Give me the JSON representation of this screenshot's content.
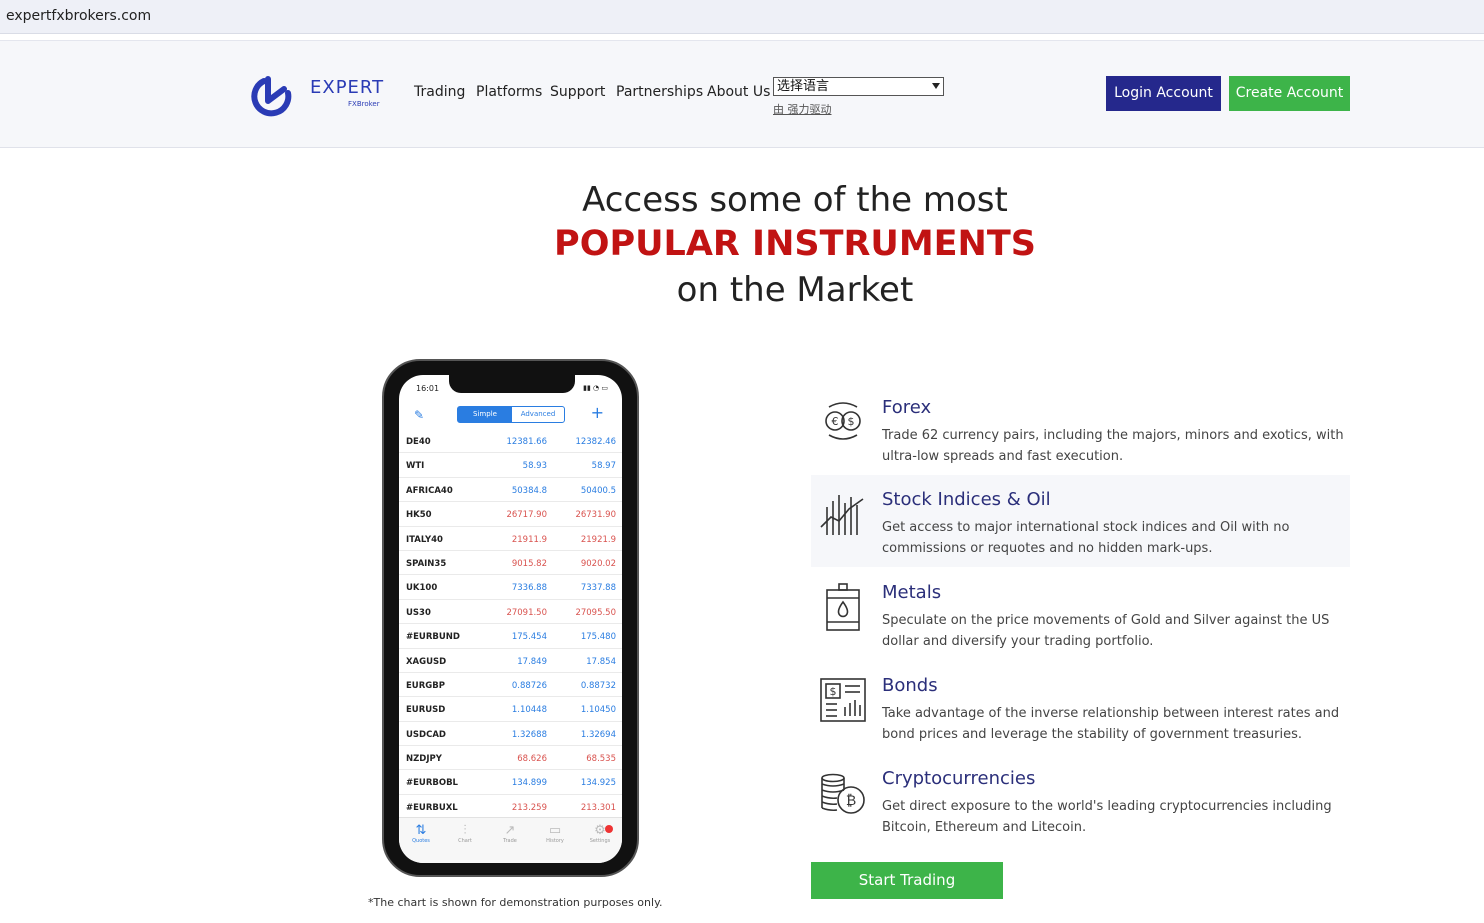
{
  "browser": {
    "url": "expertfxbrokers.com"
  },
  "header": {
    "logo_word": "EXPERT",
    "logo_sub": "FXBroker",
    "nav": [
      "Trading",
      "Platforms",
      "Support",
      "Partnerships",
      "About Us"
    ],
    "language_select": "选择语言",
    "powered_by": "由 强力驱动",
    "login_label": "Login Account",
    "create_label": "Create Account"
  },
  "hero": {
    "line1": "Access some of the most",
    "line2": "POPULAR INSTRUMENTS",
    "line3": "on the Market"
  },
  "phone": {
    "time": "16:01",
    "segment": {
      "simple": "Simple",
      "advanced": "Advanced"
    },
    "quotes": [
      {
        "symbol": "DE40",
        "bid": "12381.66",
        "ask": "12382.46",
        "color": "blue"
      },
      {
        "symbol": "WTI",
        "bid": "58.93",
        "ask": "58.97",
        "color": "blue"
      },
      {
        "symbol": "AFRICA40",
        "bid": "50384.8",
        "ask": "50400.5",
        "color": "blue"
      },
      {
        "symbol": "HK50",
        "bid": "26717.90",
        "ask": "26731.90",
        "color": "red"
      },
      {
        "symbol": "ITALY40",
        "bid": "21911.9",
        "ask": "21921.9",
        "color": "red"
      },
      {
        "symbol": "SPAIN35",
        "bid": "9015.82",
        "ask": "9020.02",
        "color": "red"
      },
      {
        "symbol": "UK100",
        "bid": "7336.88",
        "ask": "7337.88",
        "color": "blue"
      },
      {
        "symbol": "US30",
        "bid": "27091.50",
        "ask": "27095.50",
        "color": "red"
      },
      {
        "symbol": "#EURBUND",
        "bid": "175.454",
        "ask": "175.480",
        "color": "blue"
      },
      {
        "symbol": "XAGUSD",
        "bid": "17.849",
        "ask": "17.854",
        "color": "blue"
      },
      {
        "symbol": "EURGBP",
        "bid": "0.88726",
        "ask": "0.88732",
        "color": "blue"
      },
      {
        "symbol": "EURUSD",
        "bid": "1.10448",
        "ask": "1.10450",
        "color": "blue"
      },
      {
        "symbol": "USDCAD",
        "bid": "1.32688",
        "ask": "1.32694",
        "color": "blue"
      },
      {
        "symbol": "NZDJPY",
        "bid": "68.626",
        "ask": "68.535",
        "color": "red"
      },
      {
        "symbol": "#EURBOBL",
        "bid": "134.899",
        "ask": "134.925",
        "color": "blue"
      },
      {
        "symbol": "#EURBUXL",
        "bid": "213.259",
        "ask": "213.301",
        "color": "red"
      }
    ],
    "tabs": [
      "Quotes",
      "Chart",
      "Trade",
      "History",
      "Settings"
    ]
  },
  "disclaimer": "*The chart is shown for demonstration purposes only.",
  "features": [
    {
      "title": "Forex",
      "desc": "Trade 62 currency pairs, including the majors, minors and exotics, with ultra-low spreads and fast execution.",
      "icon": "currency-exchange-icon"
    },
    {
      "title": "Stock Indices & Oil",
      "desc": "Get access to major international stock indices and Oil with no commissions or requotes and no hidden mark-ups.",
      "icon": "candlestick-chart-icon"
    },
    {
      "title": "Metals",
      "desc": "Speculate on the price movements of Gold and Silver against the US dollar and diversify your trading portfolio.",
      "icon": "oil-barrel-icon"
    },
    {
      "title": "Bonds",
      "desc": "Take advantage of the inverse relationship between interest rates and bond prices and leverage the stability of government treasuries.",
      "icon": "bond-certificate-icon"
    },
    {
      "title": "Cryptocurrencies",
      "desc": "Get direct exposure to the world's leading cryptocurrencies including Bitcoin, Ethereum and Litecoin.",
      "icon": "bitcoin-coins-icon"
    }
  ],
  "start_label": "Start Trading",
  "colors": {
    "brand_blue": "#25288c",
    "green": "#3db449",
    "accent_red": "#c11313",
    "title_navy": "#2b2f7a"
  }
}
